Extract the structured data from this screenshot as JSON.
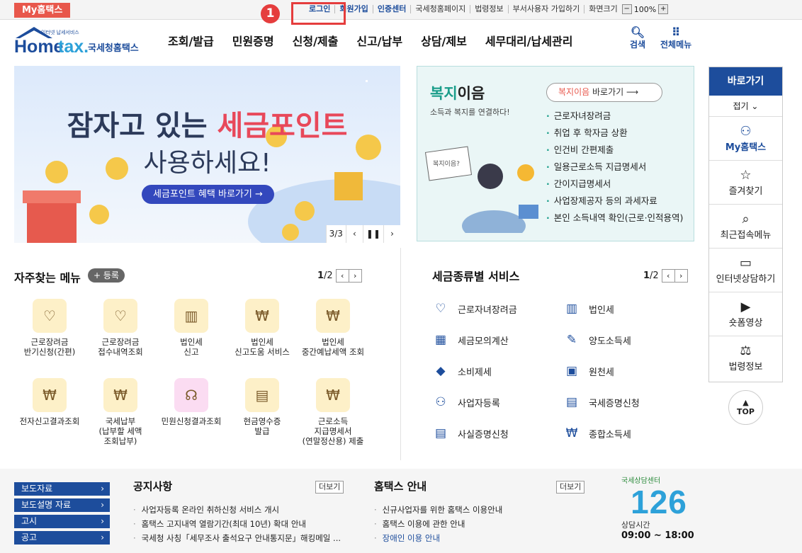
{
  "topbar": {
    "my_hometax": "My홈택스",
    "links": [
      "로그인",
      "회원가입",
      "인증센터",
      "국세청홈페이지",
      "법령정보",
      "부서사용자 가입하기",
      "화면크기"
    ],
    "zoom_minus": "−",
    "zoom_value": "100%",
    "zoom_plus": "+",
    "step_badge": "1"
  },
  "header": {
    "logo_small": "인터넷 납세서비스",
    "logo_main": "Hometax",
    "logo_sub": "국세청홈택스",
    "nav": [
      "조회/발급",
      "민원증명",
      "신청/제출",
      "신고/납부",
      "상담/제보",
      "세무대리/납세관리"
    ],
    "search_label": "검색",
    "menu_label": "전체메뉴"
  },
  "banner": {
    "line1_a": "잠자고 있는",
    "line1_b": "세금포인트",
    "line2": "사용하세요!",
    "button": "세금포인트 혜택 바로가기 →",
    "page": "3/3"
  },
  "welfare": {
    "title_a": "복지",
    "title_b": "이음",
    "subtitle": "소득과 복지를 연결하다!",
    "button_a": "복지이음",
    "button_b": "바로가기",
    "sign_text": "복지이음?",
    "items": [
      "근로자녀장려금",
      "취업 후 학자금 상환",
      "인건비 간편제출",
      "일용근로소득 지급명세서",
      "간이지급명세서",
      "사업장제공자 등의 과세자료",
      "본인 소득내역 확인(근로·인적용역)"
    ]
  },
  "sidebar": {
    "head": "바로가기",
    "fold": "접기 ⌄",
    "items": [
      {
        "label": "My홈택스",
        "icon": "person-icon"
      },
      {
        "label": "즐겨찾기",
        "icon": "star-icon"
      },
      {
        "label": "최근접속메뉴",
        "icon": "recent-icon"
      },
      {
        "label": "인터넷상담하기",
        "icon": "monitor-icon"
      },
      {
        "label": "숏폼영상",
        "icon": "play-icon"
      },
      {
        "label": "법령정보",
        "icon": "gavel-icon"
      }
    ],
    "top": "TOP"
  },
  "favorites": {
    "title": "자주찾는 메뉴",
    "register": "+ 등록",
    "page_cur": "1",
    "page_total": "/2",
    "items": [
      {
        "label": "근로장려금\n반기신청(간편)"
      },
      {
        "label": "근로장려금\n접수내역조회"
      },
      {
        "label": "법인세\n신고"
      },
      {
        "label": "법인세\n신고도움 서비스"
      },
      {
        "label": "법인세\n중간예납세액 조회"
      },
      {
        "label": "전자신고결과조회"
      },
      {
        "label": "국세납부\n(납부할 세액\n조회납부)"
      },
      {
        "label": "민원신청결과조회"
      },
      {
        "label": "현금영수증\n발급"
      },
      {
        "label": "근로소득\n지급명세서\n(연말정산용) 제출"
      }
    ]
  },
  "taxservices": {
    "title": "세금종류별 서비스",
    "page_cur": "1",
    "page_total": "/2",
    "items": [
      "근로자녀장려금",
      "법인세",
      "세금모의계산",
      "양도소득세",
      "소비제세",
      "원천세",
      "사업자등록",
      "국세증명신청",
      "사실증명신청",
      "종합소득세"
    ]
  },
  "footer": {
    "buttons": [
      "보도자료",
      "보도설명 자료",
      "고시",
      "공고"
    ],
    "notice_title": "공지사항",
    "notice_more": "더보기",
    "notices": [
      "사업자등록 온라인 취하신청 서비스 개시",
      "홈택스 고지내역 열람기간(최대 10년) 확대 안내",
      "국세청 사칭「세무조사 출석요구 안내통지문」해킹메일 ..."
    ],
    "guide_title": "홈택스 안내",
    "guide_more": "더보기",
    "guides": [
      "신규사업자를 위한 홈택스 이용안내",
      "홈택스 이용에 관한 안내",
      "장애인 이용 안내"
    ],
    "center_label": "국세상담센터",
    "center_number": "126",
    "hours_label": "상담시간",
    "hours": "09:00 ~ 18:00"
  }
}
